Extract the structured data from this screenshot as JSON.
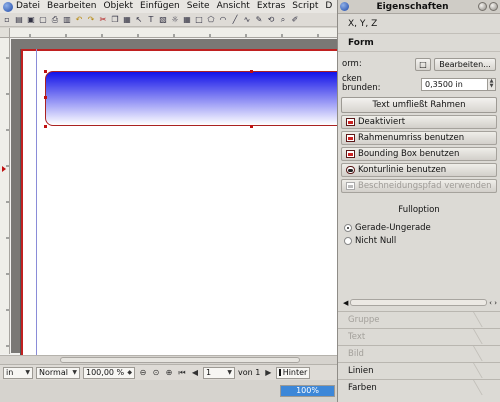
{
  "menubar": {
    "items": [
      "Datei",
      "Bearbeiten",
      "Objekt",
      "Einfügen",
      "Seite",
      "Ansicht",
      "Extras",
      "Script",
      "D"
    ]
  },
  "toolbar": {
    "icons": [
      "new-icon",
      "open-icon",
      "save-icon",
      "close-icon",
      "print-icon",
      "pdf-icon",
      "undo-icon",
      "redo-icon",
      "cut-icon",
      "copy-icon",
      "paste-icon",
      "select-icon",
      "textframe-icon",
      "imageframe-icon",
      "render-icon",
      "table-icon",
      "shape-icon",
      "polygon-icon",
      "arc-icon",
      "line-icon",
      "bezier-icon",
      "freehand-icon",
      "rotate-icon",
      "zoom-icon",
      "edit-contents-icon"
    ]
  },
  "rulers": {
    "top_ticks": [
      "1",
      "2",
      "3",
      "4",
      "5",
      "6",
      "7",
      "8",
      "9"
    ],
    "left_ticks": [
      "1",
      "2",
      "3",
      "4",
      "5",
      "6",
      "7",
      "8",
      "9"
    ]
  },
  "statusbar": {
    "unit": "in",
    "mode": "Normal",
    "zoom": "100,00 %",
    "page": "1",
    "page_of": "von 1",
    "layer": "Hinter"
  },
  "progress": {
    "label": "100%",
    "percent": 100
  },
  "panel": {
    "title": "Eigenschaften",
    "sections": {
      "xyz": "X, Y, Z",
      "form": "Form"
    },
    "form_label": "orm:",
    "edit_button": "Bearbeiten...",
    "corner_label_line1": "cken",
    "corner_label_line2": "brunden:",
    "corner_value": "0,3500 in",
    "text_flow_button": "Text umfließt Rahmen",
    "flow_options": [
      {
        "label": "Deaktiviert",
        "disabled": false
      },
      {
        "label": "Rahmenumriss benutzen",
        "disabled": false
      },
      {
        "label": "Bounding Box benutzen",
        "disabled": false
      },
      {
        "label": "Konturlinie benutzen",
        "disabled": false
      },
      {
        "label": "Beschneidungspfad verwenden",
        "disabled": true
      }
    ],
    "fill_option_title": "Fulloption",
    "fill_options": [
      {
        "label": "Gerade-Ungerade",
        "selected": true
      },
      {
        "label": "Nicht Null",
        "selected": false
      }
    ],
    "bottom_tabs": [
      {
        "label": "Gruppe",
        "disabled": true
      },
      {
        "label": "Text",
        "disabled": true
      },
      {
        "label": "Bild",
        "disabled": true
      },
      {
        "label": "Linien",
        "disabled": false
      },
      {
        "label": "Farben",
        "disabled": false
      }
    ]
  },
  "colors": {
    "gradient_start": "#1212e8",
    "gradient_end": "#ffffff",
    "margin": "#c02020",
    "accent": "#3d87d8"
  }
}
